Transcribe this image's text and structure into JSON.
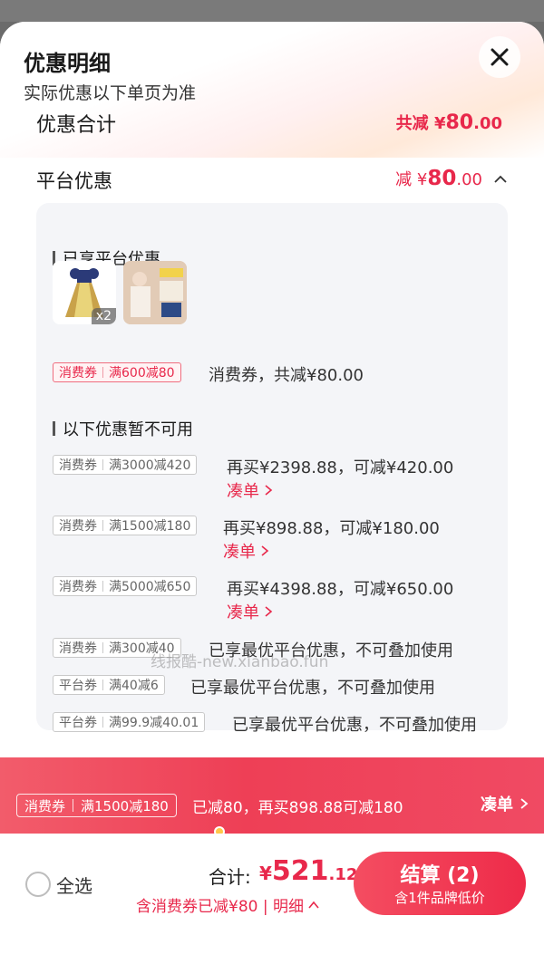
{
  "header": {
    "title": "优惠明细",
    "subtitle": "实际优惠以下单页为准"
  },
  "total_row": {
    "label": "优惠合计",
    "prefix": "共减 ",
    "currency": "¥",
    "amount": "80",
    "decimals": ".00"
  },
  "platform_row": {
    "label": "平台优惠",
    "prefix": "减 ",
    "currency": "¥",
    "amount": "80",
    "decimals": ".00"
  },
  "enjoyed": {
    "title": "已享平台优惠",
    "products": [
      {
        "qty": "x2"
      },
      {
        "qty": ""
      }
    ],
    "coupon": {
      "type": "消费券",
      "rule": "满600减80",
      "desc": "消费券，共减¥80.00"
    }
  },
  "unavailable": {
    "title": "以下优惠暂不可用",
    "items": [
      {
        "type": "消费券",
        "rule": "满3000减420",
        "desc": "再买¥2398.88，可减¥420.00",
        "action": "凑单"
      },
      {
        "type": "消费券",
        "rule": "满1500减180",
        "desc": "再买¥898.88，可减¥180.00",
        "action": "凑单"
      },
      {
        "type": "消费券",
        "rule": "满5000减650",
        "desc": "再买¥4398.88，可减¥650.00",
        "action": "凑单"
      },
      {
        "type": "消费券",
        "rule": "满300减40",
        "desc": "已享最优平台优惠，不可叠加使用"
      },
      {
        "type": "平台券",
        "rule": "满40减6",
        "desc": "已享最优平台优惠，不可叠加使用"
      },
      {
        "type": "平台券",
        "rule": "满99.9减40.01",
        "desc": "已享最优平台优惠，不可叠加使用"
      }
    ]
  },
  "watermark": "线报酷-new.xianbao.fun",
  "banner": {
    "tag_type": "消费券",
    "tag_rule": "满1500减180",
    "text": "已减80，再买898.88可减180",
    "action": "凑单"
  },
  "footer": {
    "select_all": "全选",
    "sum_label": "合计:",
    "sum_currency": "¥",
    "sum_int": "521",
    "sum_dec": ".12",
    "sum_note": "含消费券已减¥80 | 明细",
    "checkout_label": "结算 (2)",
    "checkout_sub": "含1件品牌低价"
  },
  "colors": {
    "accent": "#e8284b",
    "card_bg": "#f4f5f8"
  },
  "icons": [
    "close-icon",
    "chevron-up-icon",
    "chevron-right-icon",
    "radio-icon"
  ]
}
